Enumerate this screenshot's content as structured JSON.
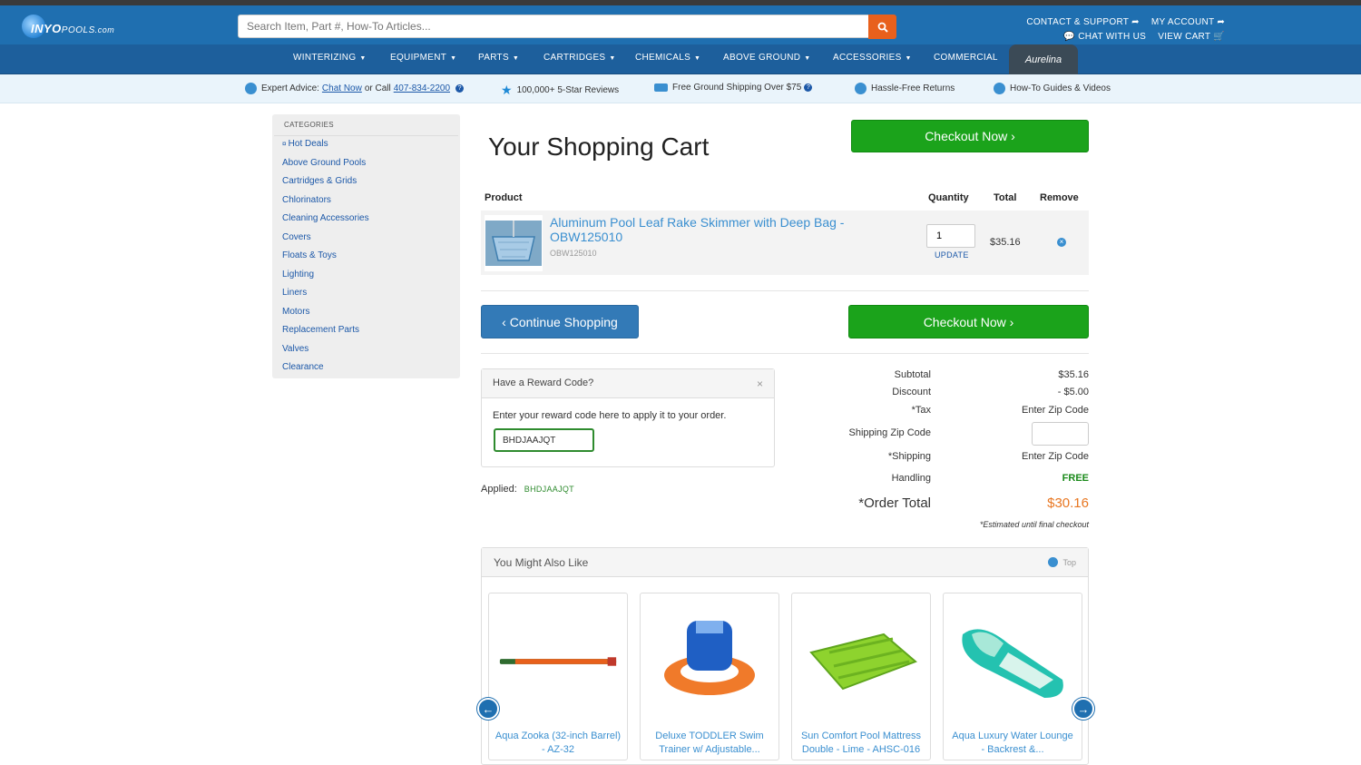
{
  "header": {
    "logo_text_1": "INYO",
    "logo_text_2": "POOLS",
    "logo_text_3": ".com",
    "search_placeholder": "Search Item, Part #, How-To Articles...",
    "contact": "CONTACT & SUPPORT",
    "my_account": "MY ACCOUNT",
    "chat": "CHAT WITH US",
    "view_cart": "VIEW CART"
  },
  "nav": {
    "items": [
      "WINTERIZING",
      "EQUIPMENT",
      "PARTS",
      "CARTRIDGES",
      "CHEMICALS",
      "ABOVE GROUND",
      "ACCESSORIES",
      "COMMERCIAL"
    ],
    "brand": "Aurelina"
  },
  "infobar": {
    "expert_prefix": "Expert Advice:",
    "chat_now": "Chat Now",
    "or_call": "or Call",
    "phone": "407-834-2200",
    "reviews": "100,000+ 5-Star Reviews",
    "shipping": "Free Ground Shipping Over $75",
    "returns": "Hassle-Free Returns",
    "guides": "How-To Guides & Videos"
  },
  "sidebar": {
    "heading": "CATEGORIES",
    "items": [
      "Hot Deals",
      "Above Ground Pools",
      "Cartridges & Grids",
      "Chlorinators",
      "Cleaning Accessories",
      "Covers",
      "Floats & Toys",
      "Lighting",
      "Liners",
      "Motors",
      "Replacement Parts",
      "Valves",
      "Clearance"
    ]
  },
  "cart": {
    "title": "Your Shopping Cart",
    "checkout_label": "Checkout Now",
    "continue_label": "Continue Shopping",
    "columns": {
      "product": "Product",
      "quantity": "Quantity",
      "total": "Total",
      "remove": "Remove"
    },
    "item": {
      "name": "Aluminum Pool Leaf Rake Skimmer with Deep Bag - OBW125010",
      "sku": "OBW125010",
      "quantity": "1",
      "update": "UPDATE",
      "total": "$35.16"
    }
  },
  "reward": {
    "heading": "Have a Reward Code?",
    "close": "×",
    "instructions": "Enter your reward code here to apply it to your order.",
    "code_value": "BHDJAAJQT",
    "applied_label": "Applied:",
    "applied_code": "BHDJAAJQT"
  },
  "summary": {
    "subtotal_label": "Subtotal",
    "subtotal": "$35.16",
    "discount_label": "Discount",
    "discount": "- $5.00",
    "tax_label": "*Tax",
    "tax": "Enter Zip Code",
    "zip_label": "Shipping Zip Code",
    "shipping_label": "*Shipping",
    "shipping": "Enter Zip Code",
    "handling_label": "Handling",
    "handling": "FREE",
    "order_total_label": "*Order Total",
    "order_total": "$30.16",
    "estimate_note": "*Estimated until final checkout"
  },
  "recommend": {
    "heading": "You Might Also Like",
    "top_label": "Top",
    "products": [
      {
        "name": "Aqua Zooka (32-inch Barrel) - AZ-32"
      },
      {
        "name": "Deluxe TODDLER Swim Trainer w/ Adjustable..."
      },
      {
        "name": "Sun Comfort Pool Mattress Double - Lime - AHSC-016"
      },
      {
        "name": "Aqua Luxury Water Lounge - Backrest &..."
      }
    ]
  },
  "colors": {
    "brand_blue": "#1f6fb0",
    "checkout_green": "#1ba31b",
    "accent_orange": "#e8601c"
  }
}
